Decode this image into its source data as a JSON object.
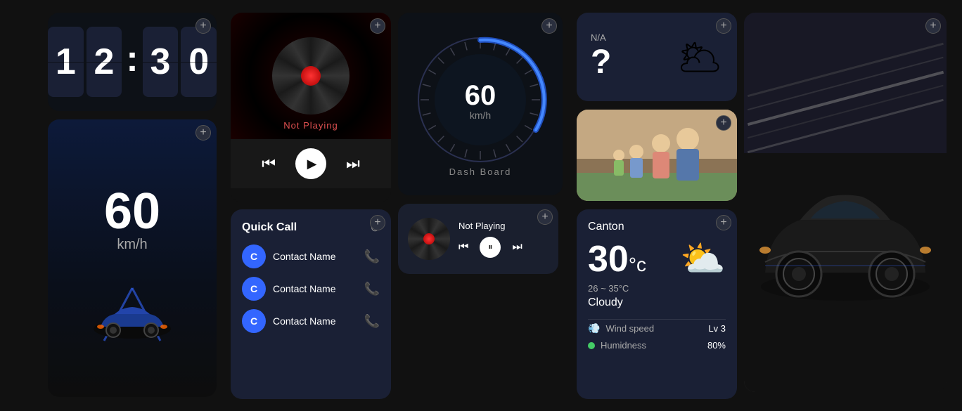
{
  "clock": {
    "digits": [
      "1",
      "2",
      "3",
      "0"
    ],
    "separator": ":"
  },
  "speedMini": {
    "value": "60",
    "unit": "km/h"
  },
  "musicPlayer": {
    "status": "Not Playing",
    "plusLabel": "+"
  },
  "speedometer": {
    "value": "60",
    "unit": "km/h",
    "label": "Dash Board"
  },
  "weatherNA": {
    "label": "N/A",
    "question": "?"
  },
  "quickCall": {
    "title": "Quick Call",
    "contacts": [
      {
        "initial": "C",
        "name": "Contact Name"
      },
      {
        "initial": "C",
        "name": "Contact Name"
      },
      {
        "initial": "C",
        "name": "Contact Name"
      }
    ]
  },
  "miniMusic": {
    "status": "Not Playing"
  },
  "weatherCanton": {
    "city": "Canton",
    "temp": "30",
    "unit": "°c",
    "range": "26 ~ 35°C",
    "condition": "Cloudy",
    "windLabel": "Wind speed",
    "windValue": "Lv 3",
    "humidityLabel": "Humidness",
    "humidityValue": "80%"
  },
  "plusIcon": "+",
  "settingsIcon": "⊙"
}
